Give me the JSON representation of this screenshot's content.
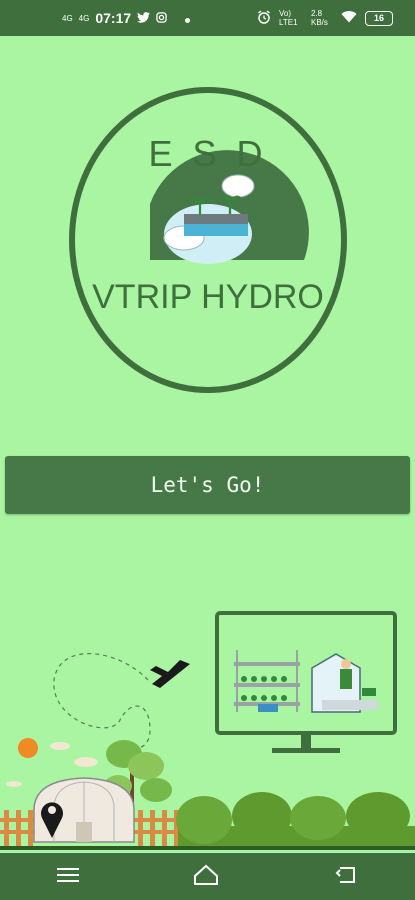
{
  "status_bar": {
    "network_1": "4G",
    "network_2": "4G",
    "time": "07:17",
    "icons_left": [
      "twitter-icon",
      "instagram-icon",
      "dot-icon"
    ],
    "volte": "Vo) LTE1",
    "speed": "2.8 KB/s",
    "battery": "16"
  },
  "logo": {
    "top_text": "E S D",
    "brand_text": "VTRIP HYDRO"
  },
  "cta": {
    "label": "Let's Go!"
  },
  "nav_bar": {
    "icons": [
      "menu-icon",
      "home-icon",
      "back-icon"
    ]
  },
  "colors": {
    "background": "#a9f5a2",
    "primary": "#467947",
    "bar": "#3e6f3c"
  }
}
